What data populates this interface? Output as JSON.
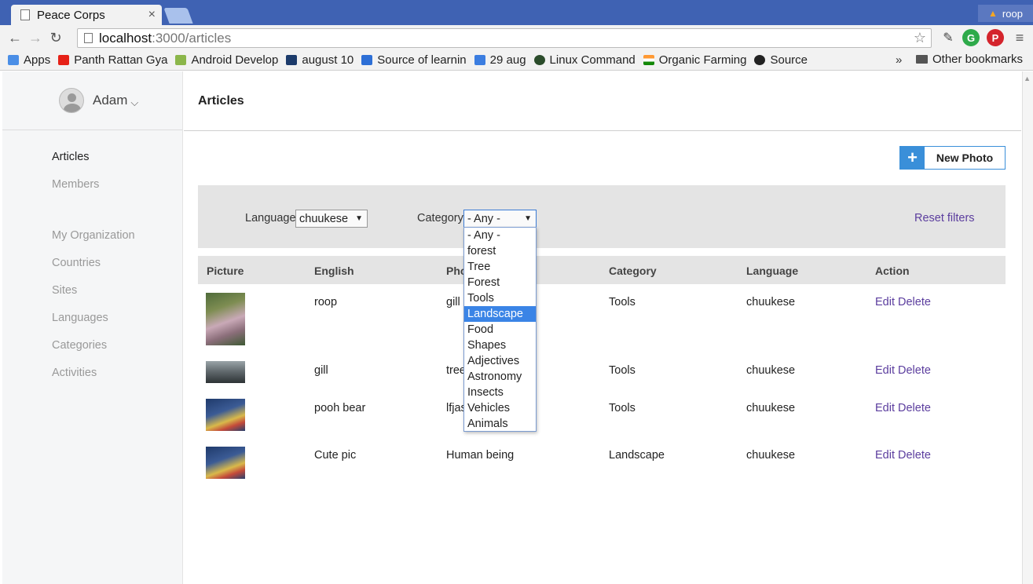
{
  "browser": {
    "tab_title": "Peace Corps",
    "tab_close": "×",
    "profile_name": "roop",
    "url_host": "localhost",
    "url_path": ":3000/articles",
    "bookmarks": [
      {
        "label": "Apps",
        "color": "#4a8ee6"
      },
      {
        "label": "Panth Rattan Gya",
        "color": "#e62117"
      },
      {
        "label": "Android Develop",
        "color": "#8bb64a"
      },
      {
        "label": "august 10",
        "color": "#1c3b6b"
      },
      {
        "label": "Source of learnin",
        "color": "#2d6fd6"
      },
      {
        "label": "29 aug",
        "color": "#3b7de0"
      },
      {
        "label": "Linux Command",
        "color": "#2b4c2b"
      },
      {
        "label": "Organic Farming",
        "color": "#ff9933"
      },
      {
        "label": "Source",
        "color": "#222222"
      }
    ],
    "bookmarks_more": "»",
    "other_bookmarks": "Other bookmarks"
  },
  "user": {
    "name": "Adam"
  },
  "sidebar": {
    "items": [
      {
        "label": "Articles",
        "active": true
      },
      {
        "label": "Members"
      },
      {
        "label": "My Organization"
      },
      {
        "label": "Countries"
      },
      {
        "label": "Sites"
      },
      {
        "label": "Languages"
      },
      {
        "label": "Categories"
      },
      {
        "label": "Activities"
      }
    ]
  },
  "header": {
    "title": "Articles"
  },
  "actions": {
    "new_photo": "New Photo",
    "new_photo_icon": "+"
  },
  "filters": {
    "language_label": "Language",
    "language_value": "chuukese",
    "category_label": "Category",
    "category_value": "- Any -",
    "reset": "Reset filters",
    "category_options": [
      "- Any -",
      "forest",
      "Tree",
      "Forest",
      "Tools",
      "Landscape",
      "Food",
      "Shapes",
      "Adjectives",
      "Astronomy",
      "Insects",
      "Vehicles",
      "Animals"
    ],
    "highlighted_option": "Landscape"
  },
  "table": {
    "headers": [
      "Picture",
      "English",
      "Pho",
      "Category",
      "Language",
      "Action"
    ],
    "rows": [
      {
        "english": "roop",
        "phonetic": "gill",
        "category": "Tools",
        "language": "chuukese",
        "edit": "Edit",
        "delete": "Delete"
      },
      {
        "english": "gill",
        "phonetic": "tree",
        "category": "Tools",
        "language": "chuukese",
        "edit": "Edit",
        "delete": "Delete"
      },
      {
        "english": "pooh bear",
        "phonetic": "lfjas",
        "category": "Tools",
        "language": "chuukese",
        "edit": "Edit",
        "delete": "Delete"
      },
      {
        "english": "Cute pic",
        "phonetic": "Human being",
        "category": "Landscape",
        "language": "chuukese",
        "edit": "Edit",
        "delete": "Delete"
      }
    ]
  }
}
